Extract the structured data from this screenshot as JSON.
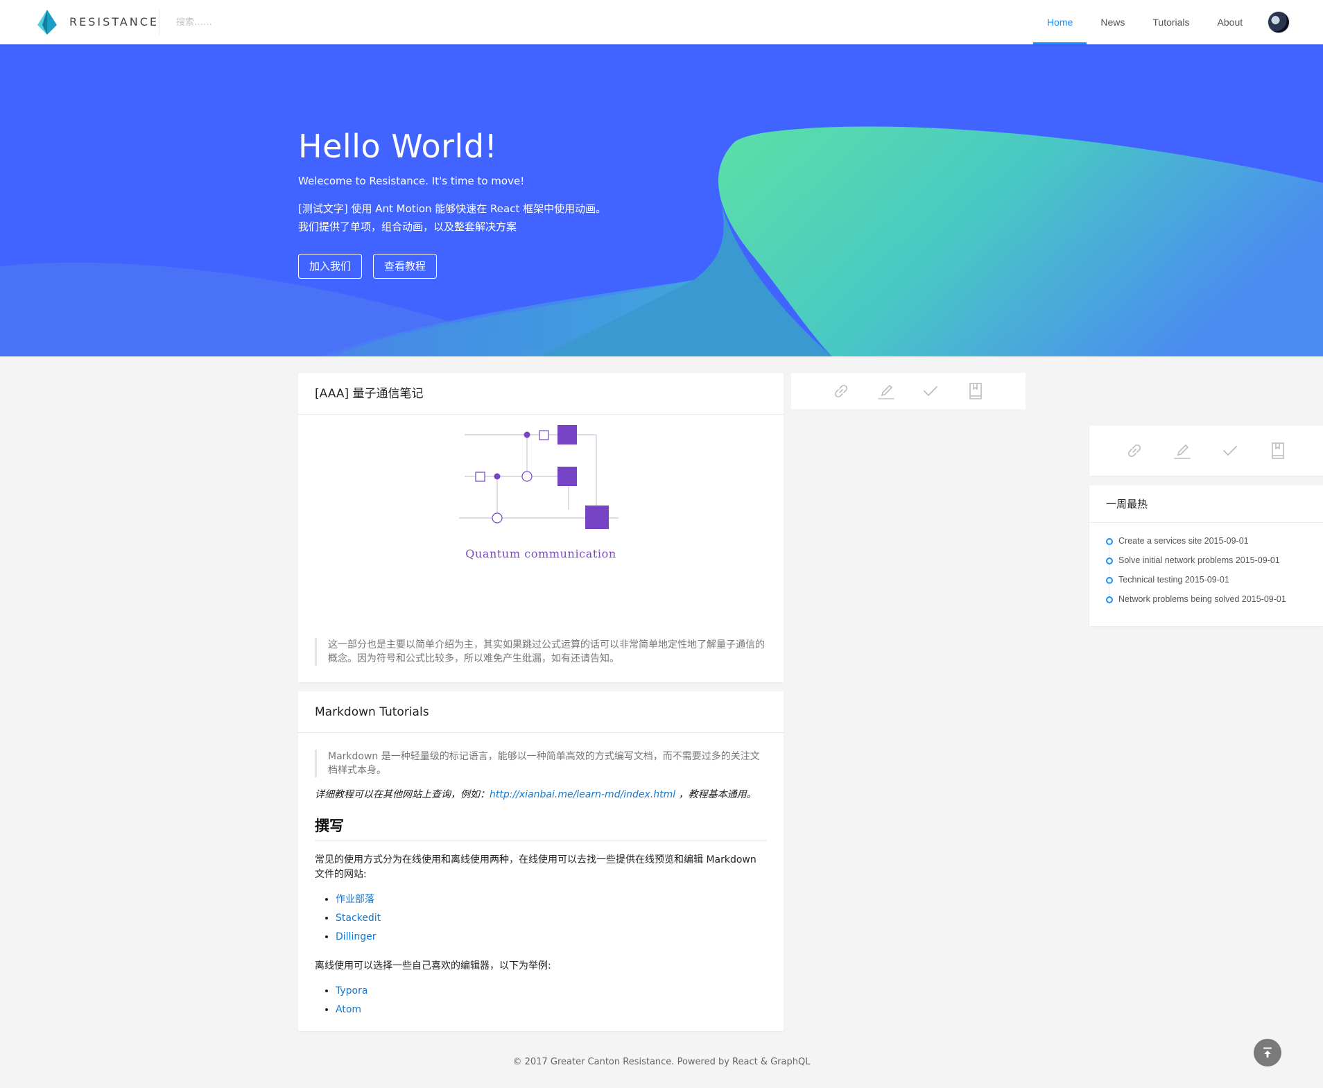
{
  "header": {
    "brand": "Resistance",
    "search_placeholder": "搜索……",
    "nav": [
      "Home",
      "News",
      "Tutorials",
      "About"
    ],
    "active_nav": "Home",
    "accent": "#1890ff"
  },
  "banner": {
    "title": "Hello World!",
    "subtitle": "Welecome to Resistance. It's time to move!",
    "desc_line1": "[测试文字] 使用 Ant Motion 能够快速在 React 框架中使用动画。",
    "desc_line2": "我们提供了单项，组合动画，以及整套解决方案",
    "btn_join": "加入我们",
    "btn_tutorial": "查看教程",
    "bg_color": "#4163ff"
  },
  "card1": {
    "title": "[AAA] 量子通信笔记",
    "figure_caption": "Quantum communication",
    "quote": "这一部分也是主要以简单介绍为主，其实如果跳过公式运算的话可以非常简单地定性地了解量子通信的概念。因为符号和公式比较多，所以难免产生纰漏，如有还请告知。"
  },
  "card2": {
    "title": "Markdown Tutorials",
    "quote": "Markdown 是一种轻量级的标记语言，能够以一种简单高效的方式编写文档，而不需要过多的关注文档样式本身。",
    "italic_prefix": "详细教程可以在其他网站上查询，例如：",
    "italic_link": "http://xianbai.me/learn-md/index.html",
    "italic_suffix": " ，教程基本通用。",
    "heading": "撰写",
    "para1": "常见的使用方式分为在线使用和离线使用两种，在线使用可以去找一些提供在线预览和编辑 Markdown 文件的网站:",
    "online_links": [
      "作业部落",
      "Stackedit",
      "Dillinger"
    ],
    "para2": "离线使用可以选择一些自己喜欢的编辑器，以下为举例:",
    "offline_links": [
      "Typora",
      "Atom"
    ]
  },
  "actions": [
    "link-icon",
    "edit-icon",
    "check-icon",
    "book-icon"
  ],
  "hot": {
    "title": "一周最热",
    "items": [
      "Create a services site 2015-09-01",
      "Solve initial network problems 2015-09-01",
      "Technical testing 2015-09-01",
      "Network problems being solved 2015-09-01"
    ]
  },
  "footer": "© 2017 Greater Canton Resistance. Powered by React & GraphQL"
}
